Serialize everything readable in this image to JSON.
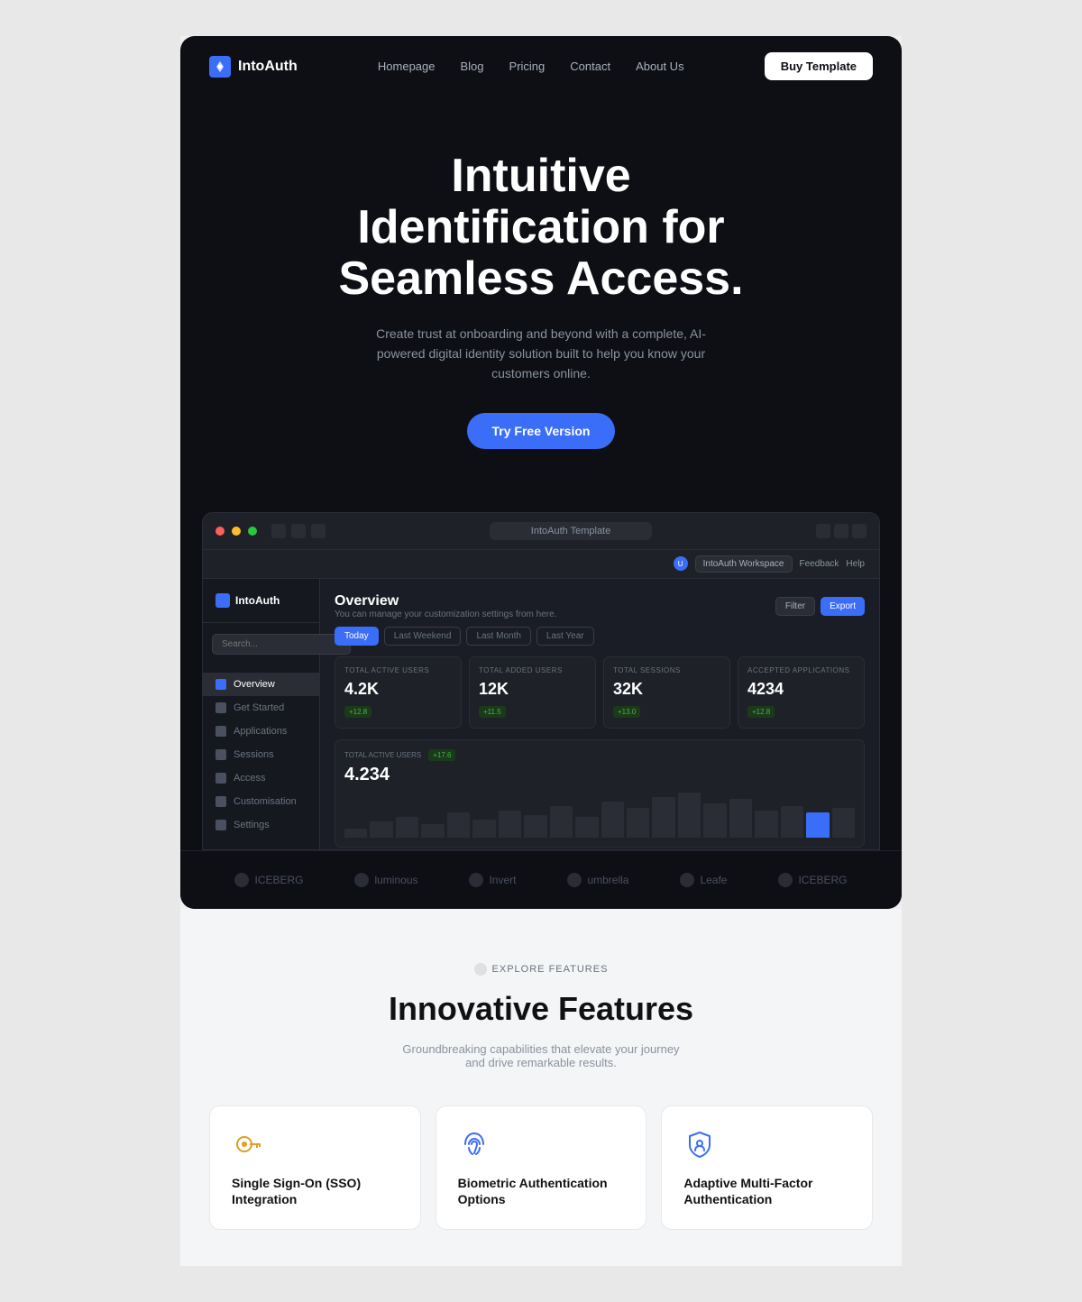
{
  "nav": {
    "logo": "IntoAuth",
    "links": [
      "Homepage",
      "Blog",
      "Pricing",
      "Contact",
      "About Us"
    ],
    "cta": "Buy Template"
  },
  "hero": {
    "title_line1": "Intuitive",
    "title_line2": "Identification for",
    "title_line3": "Seamless Access.",
    "subtitle": "Create trust at onboarding and beyond with a complete, AI-powered digital identity solution built to help you know your customers online.",
    "cta": "Try Free Version"
  },
  "dashboard": {
    "url": "IntoAuth Template",
    "logo": "IntoAuth",
    "sidebar_items": [
      {
        "label": "Overview",
        "active": true
      },
      {
        "label": "Get Started",
        "active": false
      },
      {
        "label": "Applications",
        "active": false
      },
      {
        "label": "Sessions",
        "active": false
      },
      {
        "label": "Access",
        "active": false
      },
      {
        "label": "Customisation",
        "active": false
      },
      {
        "label": "Settings",
        "active": false
      }
    ],
    "workspace": "IntoAuth Workspace",
    "feedback": "Feedback",
    "help": "Help",
    "search_placeholder": "Search...",
    "main_title": "Overview",
    "main_subtitle": "You can manage your customization settings from here.",
    "date_tabs": [
      "Today",
      "Last Weekend",
      "Last Month",
      "Last Year"
    ],
    "active_date_tab": "Today",
    "filter_btn": "Filter",
    "export_btn": "Export",
    "stats": [
      {
        "label": "TOTAL ACTIVE USERS",
        "value": "4.2K",
        "badge": "+12.8"
      },
      {
        "label": "TOTAL ADDED USERS",
        "value": "12K",
        "badge": "+11.5"
      },
      {
        "label": "TOTAL SESSIONS",
        "value": "32K",
        "badge": "+13.0"
      },
      {
        "label": "ACCEPTED APPLICATIONS",
        "value": "4234",
        "badge": "+12.8"
      }
    ],
    "chart": {
      "label": "TOTAL ACTIVE USERS",
      "badge": "+17.6",
      "value": "4.234",
      "bars": [
        20,
        35,
        45,
        30,
        55,
        40,
        60,
        50,
        70,
        45,
        80,
        65,
        90,
        100,
        75,
        85,
        60,
        70,
        55,
        65
      ]
    }
  },
  "brands": [
    {
      "name": "ICEBERG"
    },
    {
      "name": "luminous"
    },
    {
      "name": "Invert"
    },
    {
      "name": "umbrella"
    },
    {
      "name": "Leafe"
    },
    {
      "name": "ICEBERG"
    }
  ],
  "features": {
    "explore_label": "EXPLORE FEATURES",
    "title": "Innovative Features",
    "subtitle": "Groundbreaking capabilities that elevate your journey and drive remarkable results.",
    "cards": [
      {
        "icon": "key",
        "title": "Single Sign-On (SSO) Integration"
      },
      {
        "icon": "fingerprint",
        "title": "Biometric Authentication Options"
      },
      {
        "icon": "shield",
        "title": "Adaptive Multi-Factor Authentication"
      }
    ]
  }
}
